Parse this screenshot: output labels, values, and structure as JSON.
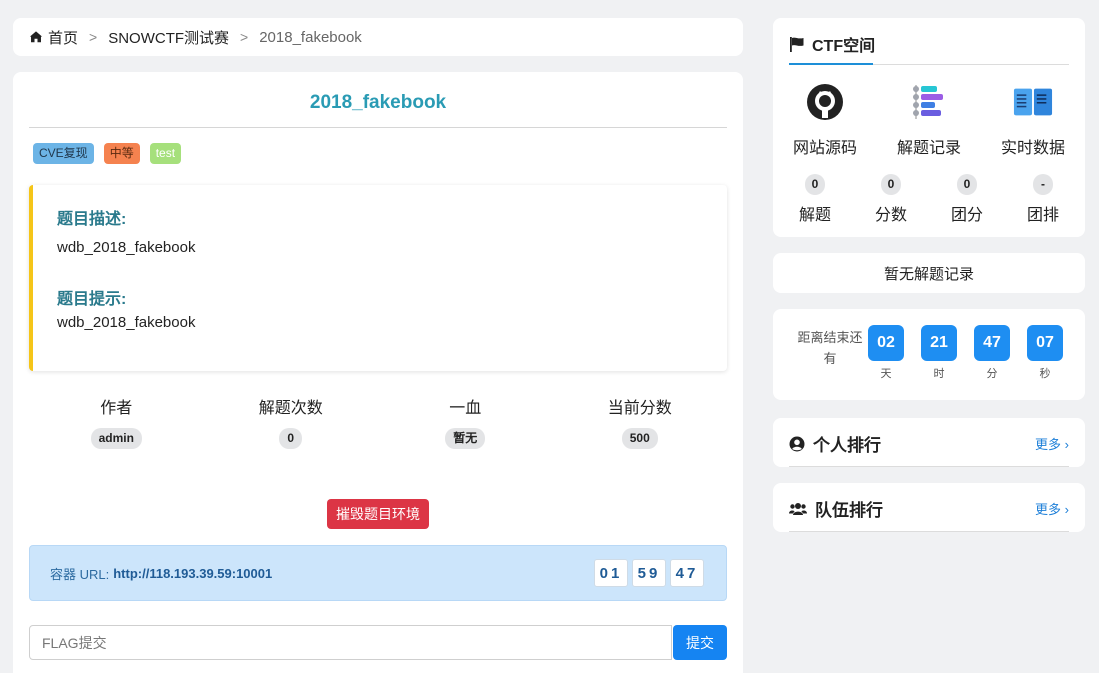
{
  "breadcrumb": {
    "home": "首页",
    "sep": ">",
    "competition": "SNOWCTF测试赛",
    "current": "2018_fakebook"
  },
  "challenge": {
    "title": "2018_fakebook",
    "tags": [
      "CVE复现",
      "中等",
      "test"
    ],
    "description_heading": "题目描述:",
    "description": "wdb_2018_fakebook",
    "hint_heading": "题目提示:",
    "hint": "wdb_2018_fakebook",
    "stats": [
      {
        "label": "作者",
        "value": "admin"
      },
      {
        "label": "解题次数",
        "value": "0"
      },
      {
        "label": "一血",
        "value": "暂无"
      },
      {
        "label": "当前分数",
        "value": "500"
      }
    ],
    "destroy_label": "摧毁题目环境",
    "container": {
      "label": "容器 URL:",
      "url": "http://118.193.39.59:10001",
      "timer": [
        "01",
        "59",
        "47"
      ]
    },
    "flag_placeholder": "FLAG提交",
    "submit_label": "提交"
  },
  "sidebar": {
    "ctf_title": "CTF空间",
    "links": [
      {
        "label": "网站源码",
        "icon": "github-icon"
      },
      {
        "label": "解题记录",
        "icon": "timeline-icon"
      },
      {
        "label": "实时数据",
        "icon": "book-icon"
      }
    ],
    "counts": [
      {
        "value": "0",
        "label": "解题"
      },
      {
        "value": "0",
        "label": "分数"
      },
      {
        "value": "0",
        "label": "团分"
      },
      {
        "value": "-",
        "label": "团排"
      }
    ],
    "no_record": "暂无解题记录",
    "countdown": {
      "label": "距离结束还有",
      "units": [
        {
          "value": "02",
          "unit": "天"
        },
        {
          "value": "21",
          "unit": "时"
        },
        {
          "value": "47",
          "unit": "分"
        },
        {
          "value": "07",
          "unit": "秒"
        }
      ]
    },
    "personal_rank": {
      "title": "个人排行",
      "more": "更多 ›"
    },
    "team_rank": {
      "title": "队伍排行",
      "more": "更多 ›"
    }
  },
  "colors": {
    "accent": "#2a9bb4",
    "danger": "#dc3545",
    "primary": "#1584f2",
    "countdown": "#1e8ef2",
    "info_bg": "#cce5fb"
  }
}
